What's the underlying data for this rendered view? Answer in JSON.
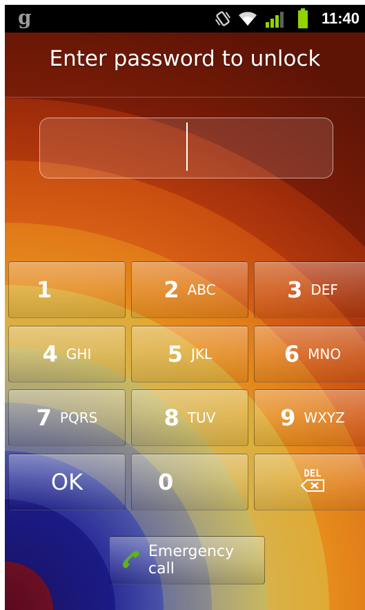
{
  "statusbar": {
    "app_letter": "g",
    "time": "11:40",
    "icons": [
      "vibrate-icon",
      "wifi-icon",
      "signal-icon",
      "battery-icon"
    ]
  },
  "title": "Enter password to unlock",
  "password_field": {
    "value": ""
  },
  "keypad": {
    "k1": {
      "num": "1",
      "letters": ""
    },
    "k2": {
      "num": "2",
      "letters": "ABC"
    },
    "k3": {
      "num": "3",
      "letters": "DEF"
    },
    "k4": {
      "num": "4",
      "letters": "GHI"
    },
    "k5": {
      "num": "5",
      "letters": "JKL"
    },
    "k6": {
      "num": "6",
      "letters": "MNO"
    },
    "k7": {
      "num": "7",
      "letters": "PQRS"
    },
    "k8": {
      "num": "8",
      "letters": "TUV"
    },
    "k9": {
      "num": "9",
      "letters": "WXYZ"
    },
    "ok": "OK",
    "k0": {
      "num": "0"
    },
    "del": "DEL"
  },
  "emergency_call": "Emergency call",
  "colors": {
    "status_bar": "#000000",
    "battery": "#8fd400",
    "signal": "#8fd400",
    "phone_icon": "#5cb31a"
  }
}
